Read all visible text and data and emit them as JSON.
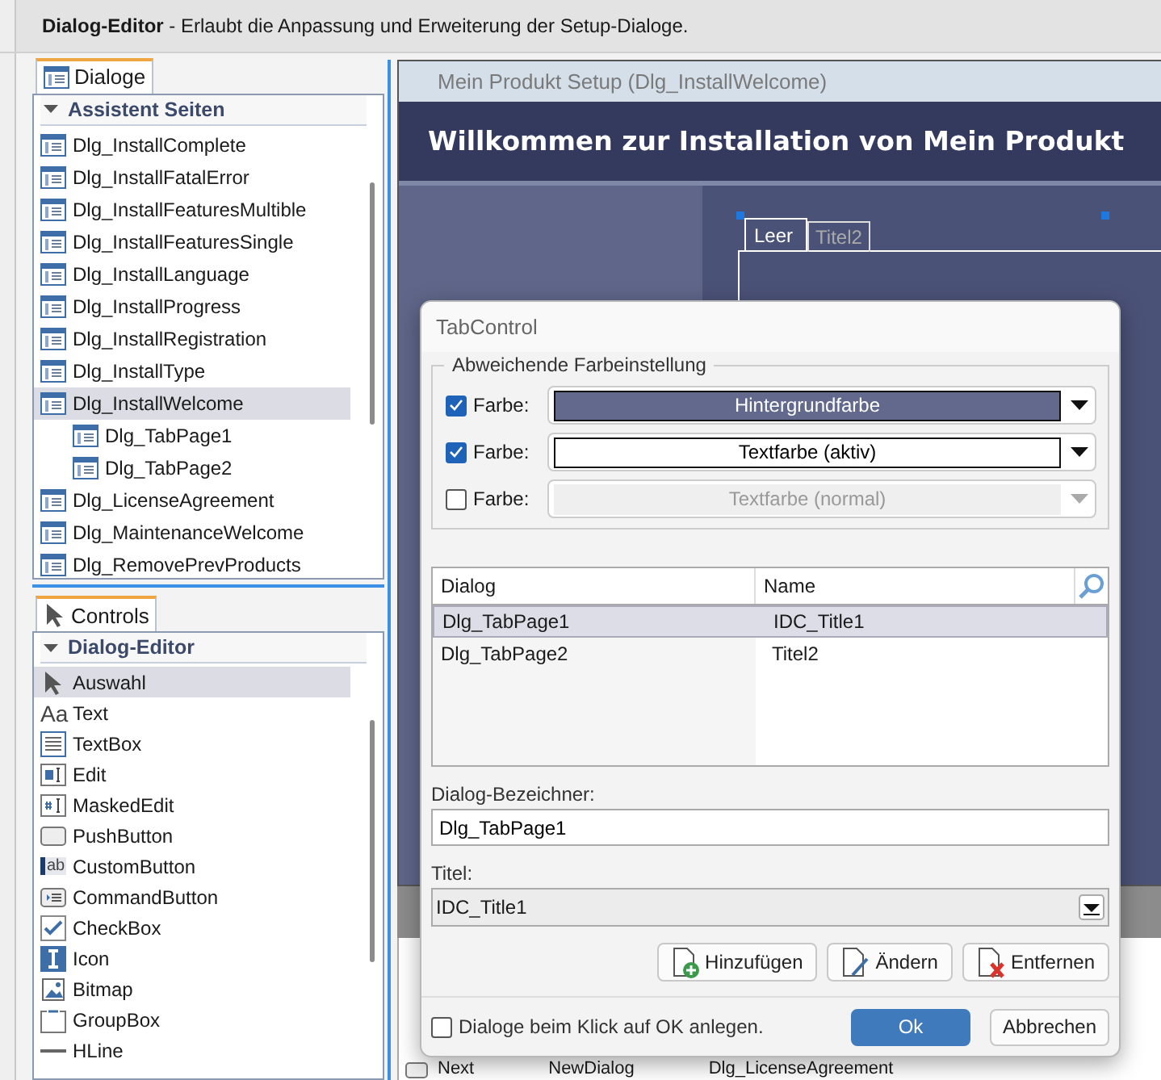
{
  "header": {
    "title": "Dialog-Editor",
    "description": " - Erlaubt die Anpassung und Erweiterung der Setup-Dialoge."
  },
  "dialogs_panel": {
    "tab": "Dialoge",
    "group": {
      "label": "Assistent Seiten",
      "expanded": true
    },
    "items": [
      {
        "label": "Dlg_InstallComplete",
        "selected": false
      },
      {
        "label": "Dlg_InstallFatalError",
        "selected": false
      },
      {
        "label": "Dlg_InstallFeaturesMultible",
        "selected": false
      },
      {
        "label": "Dlg_InstallFeaturesSingle",
        "selected": false
      },
      {
        "label": "Dlg_InstallLanguage",
        "selected": false
      },
      {
        "label": "Dlg_InstallProgress",
        "selected": false
      },
      {
        "label": "Dlg_InstallRegistration",
        "selected": false
      },
      {
        "label": "Dlg_InstallType",
        "selected": false
      },
      {
        "label": "Dlg_InstallWelcome",
        "selected": true,
        "children": [
          {
            "label": "Dlg_TabPage1",
            "selected": false
          },
          {
            "label": "Dlg_TabPage2",
            "selected": false
          }
        ]
      },
      {
        "label": "Dlg_LicenseAgreement",
        "selected": false
      },
      {
        "label": "Dlg_MaintenanceWelcome",
        "selected": false
      },
      {
        "label": "Dlg_RemovePrevProducts",
        "selected": false
      }
    ]
  },
  "controls_panel": {
    "tab": "Controls",
    "group": {
      "label": "Dialog-Editor",
      "expanded": true
    },
    "items": [
      {
        "label": "Auswahl",
        "kind": "pointer",
        "selected": true
      },
      {
        "label": "Text",
        "kind": "text",
        "glyph": "Aa",
        "selected": false
      },
      {
        "label": "TextBox",
        "kind": "textbox",
        "selected": false
      },
      {
        "label": "Edit",
        "kind": "edit",
        "selected": false
      },
      {
        "label": "MaskedEdit",
        "kind": "maskededit",
        "selected": false
      },
      {
        "label": "PushButton",
        "kind": "pushbutton",
        "selected": false
      },
      {
        "label": "CustomButton",
        "kind": "custombutton",
        "glyph": "ab",
        "selected": false
      },
      {
        "label": "CommandButton",
        "kind": "commandbutton",
        "selected": false
      },
      {
        "label": "CheckBox",
        "kind": "checkbox",
        "selected": false
      },
      {
        "label": "Icon",
        "kind": "icon",
        "selected": false
      },
      {
        "label": "Bitmap",
        "kind": "bitmap",
        "selected": false
      },
      {
        "label": "GroupBox",
        "kind": "groupbox",
        "selected": false
      },
      {
        "label": "HLine",
        "kind": "hline",
        "selected": false
      }
    ]
  },
  "designer": {
    "window_title": "Mein Produkt Setup  (Dlg_InstallWelcome)",
    "banner": "Willkommen zur Installation von Mein Produkt",
    "tabs": [
      {
        "label": "Leer",
        "selected": true
      },
      {
        "label": "Titel2",
        "selected": false
      }
    ],
    "background_row": [
      "Next",
      "NewDialog",
      "Dlg_LicenseAgreement"
    ]
  },
  "dialog": {
    "title": "TabControl",
    "group_label": "Abweichende Farbeinstellung",
    "color_rows": [
      {
        "label": "Farbe:",
        "checked": true,
        "value": "Hintergrundfarbe",
        "color": "#62698c"
      },
      {
        "label": "Farbe:",
        "checked": true,
        "value": "Textfarbe (aktiv)",
        "color": "#ffffff"
      },
      {
        "label": "Farbe:",
        "checked": false,
        "value": "Textfarbe (normal)",
        "color": "#efefef"
      }
    ],
    "table": {
      "columns": [
        "Dialog",
        "Name"
      ],
      "rows": [
        {
          "cells": [
            "Dlg_TabPage1",
            "IDC_Title1"
          ],
          "selected": true
        },
        {
          "cells": [
            "Dlg_TabPage2",
            "Titel2"
          ],
          "selected": false
        }
      ]
    },
    "identifier": {
      "label": "Dialog-Bezeichner:",
      "value": "Dlg_TabPage1"
    },
    "title_field": {
      "label": "Titel:",
      "value": "IDC_Title1"
    },
    "actions": [
      {
        "label": "Hinzufügen",
        "kind": "add"
      },
      {
        "label": "Ändern",
        "kind": "edit"
      },
      {
        "label": "Entfernen",
        "kind": "remove"
      }
    ],
    "create_on_ok": {
      "label": "Dialoge beim Klick auf OK anlegen.",
      "checked": false
    },
    "buttons": [
      {
        "label": "Ok",
        "kind": "primary"
      },
      {
        "label": "Abbrechen",
        "kind": "secondary"
      }
    ]
  }
}
